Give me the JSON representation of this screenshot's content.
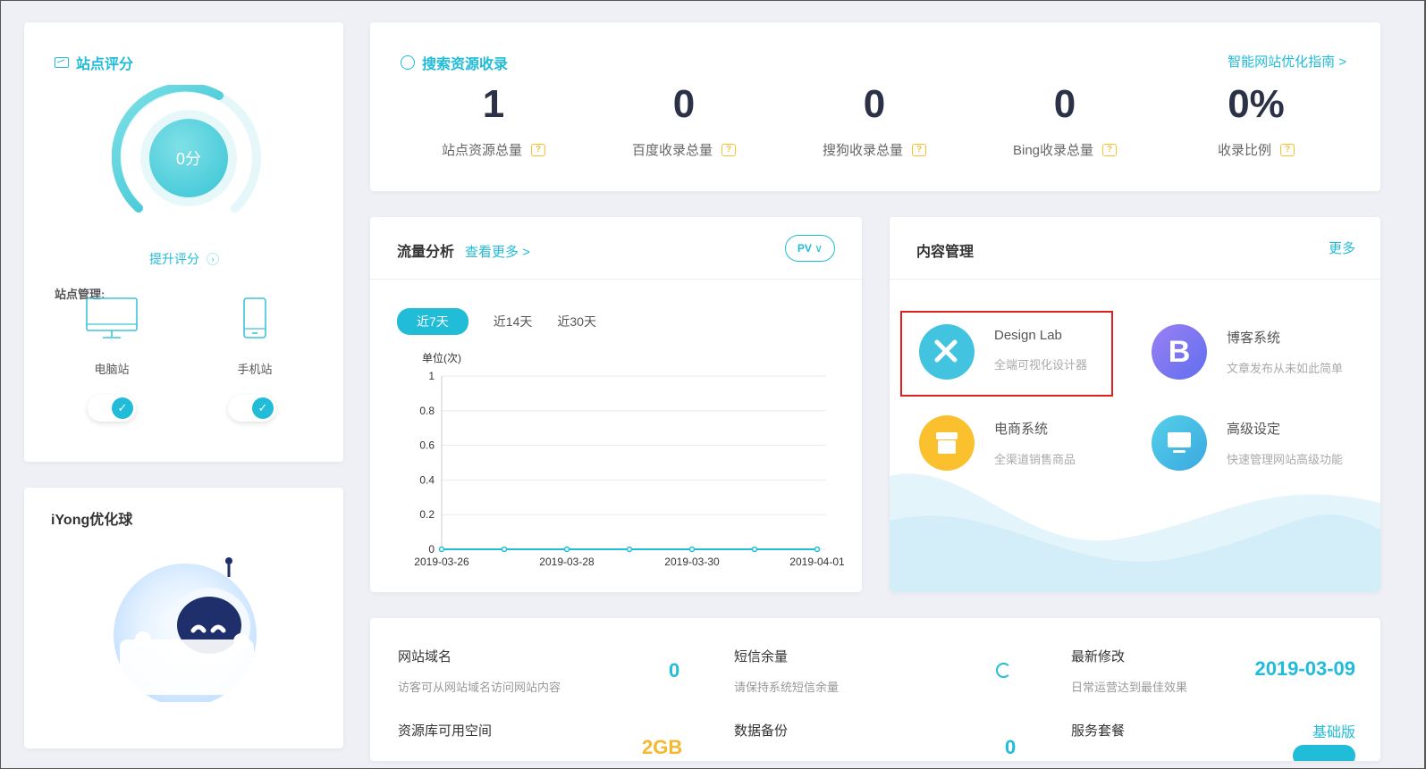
{
  "score_card": {
    "title": "站点评分",
    "score": "0分",
    "improve_label": "提升评分",
    "site_mgmt_label": "站点管理:",
    "devices": [
      {
        "label": "电脑站",
        "enabled": true
      },
      {
        "label": "手机站",
        "enabled": true
      }
    ]
  },
  "iyong_card": {
    "title": "iYong优化球"
  },
  "search_card": {
    "title": "搜索资源收录",
    "guide_link": "智能网站优化指南 >",
    "stats": [
      {
        "value": "1",
        "label": "站点资源总量"
      },
      {
        "value": "0",
        "label": "百度收录总量"
      },
      {
        "value": "0",
        "label": "搜狗收录总量"
      },
      {
        "value": "0",
        "label": "Bing收录总量"
      },
      {
        "value": "0%",
        "label": "收录比例"
      }
    ]
  },
  "traffic_card": {
    "title": "流量分析",
    "more_link": "查看更多 >",
    "metric": "PV",
    "ranges": [
      "近7天",
      "近14天",
      "近30天"
    ],
    "active_range": "近7天"
  },
  "chart_data": {
    "type": "line",
    "ylabel": "单位(次)",
    "ylim": [
      0,
      1
    ],
    "yticks": [
      "1",
      "0.8",
      "0.6",
      "0.4",
      "0.2",
      "0"
    ],
    "x": [
      "2019-03-26",
      "2019-03-27",
      "2019-03-28",
      "2019-03-29",
      "2019-03-30",
      "2019-03-31",
      "2019-04-01"
    ],
    "xtick_labels": [
      "2019-03-26",
      "2019-03-28",
      "2019-03-30",
      "2019-04-01"
    ],
    "series": [
      {
        "values": [
          0,
          0,
          0,
          0,
          0,
          0,
          0
        ]
      }
    ],
    "grid": true,
    "color": "#21bcd8"
  },
  "content_card": {
    "title": "内容管理",
    "more_link": "更多",
    "items": [
      {
        "title": "Design Lab",
        "desc": "全端可视化设计器",
        "icon": "design-lab-icon",
        "color": "#42c3df"
      },
      {
        "title": "博客系统",
        "desc": "文章发布从未如此简单",
        "icon": "blog-b-icon",
        "color": "#7b6ff0"
      },
      {
        "title": "电商系统",
        "desc": "全渠道销售商品",
        "icon": "shop-icon",
        "color": "#fbc02d"
      },
      {
        "title": "高级设定",
        "desc": "快速管理网站高级功能",
        "icon": "monitor-icon",
        "color": "#3fbde0"
      }
    ]
  },
  "bottom_card": {
    "rows": [
      [
        {
          "title": "网站域名",
          "desc": "访客可从网站域名访问网站内容",
          "value": "0"
        },
        {
          "title": "短信余量",
          "desc": "请保持系统短信余量",
          "value": ""
        },
        {
          "title": "最新修改",
          "desc": "日常运营达到最佳效果",
          "value": "2019-03-09"
        }
      ],
      [
        {
          "title": "资源库可用空间",
          "value": "2GB"
        },
        {
          "title": "数据备份",
          "value": "0"
        },
        {
          "title": "服务套餐",
          "value": "基础版"
        }
      ]
    ]
  },
  "colors": {
    "accent": "#21bcd8",
    "yellow": "#f5b82e",
    "text_dark": "#2b3248"
  }
}
